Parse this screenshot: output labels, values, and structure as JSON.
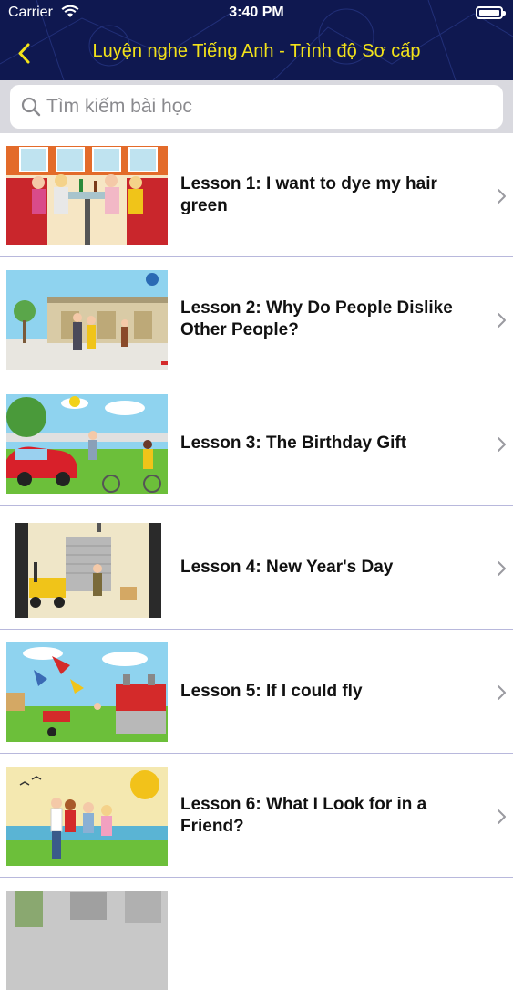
{
  "status_bar": {
    "carrier": "Carrier",
    "time": "3:40 PM"
  },
  "nav": {
    "title": "Luyện nghe Tiếng Anh - Trình độ Sơ cấp",
    "back_icon": "chevron-left-icon"
  },
  "search": {
    "placeholder": "Tìm kiếm bài học",
    "value": "",
    "icon": "search-icon"
  },
  "colors": {
    "header_bg": "#0f1850",
    "title_color": "#f2e21a",
    "accent": "#f2e21a",
    "divider": "#b8b8dc"
  },
  "lessons": [
    {
      "title": "Lesson 1: I want to dye my hair green",
      "thumbnail": "cartoon-cafe-women-image"
    },
    {
      "title": "Lesson 2: Why Do People Dislike Other People?",
      "thumbnail": "cartoon-street-people-image"
    },
    {
      "title": "Lesson 3: The Birthday Gift",
      "thumbnail": "cartoon-red-car-bicycle-image"
    },
    {
      "title": "Lesson 4: New Year's Day",
      "thumbnail": "cartoon-warehouse-forklift-image"
    },
    {
      "title": "Lesson 5: If I could fly",
      "thumbnail": "cartoon-flying-people-image"
    },
    {
      "title": "Lesson 6: What I Look for in a Friend?",
      "thumbnail": "cartoon-friends-beach-image"
    },
    {
      "title": "",
      "thumbnail": "cartoon-partial-image"
    }
  ]
}
